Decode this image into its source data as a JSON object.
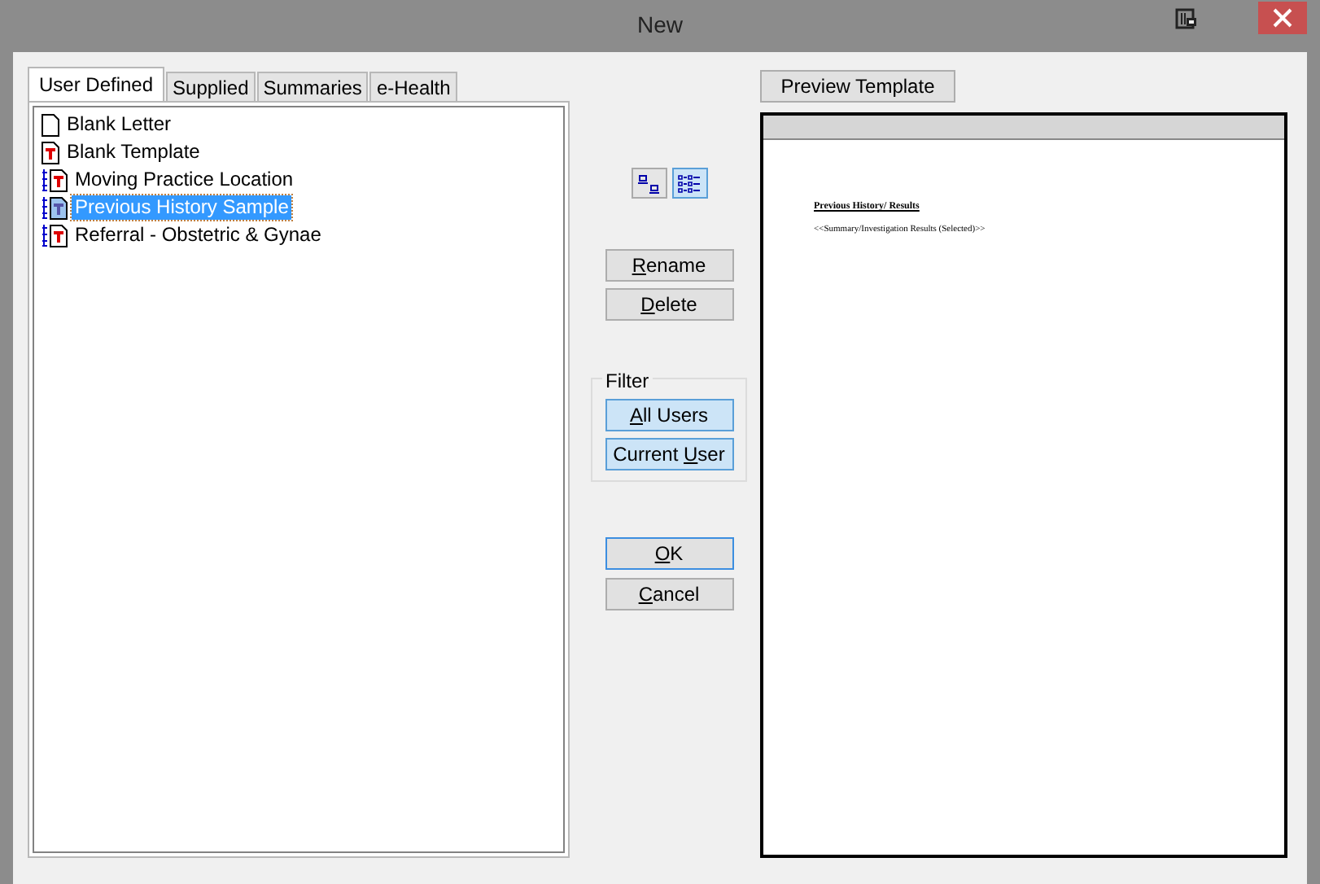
{
  "window": {
    "title": "New"
  },
  "tabs": [
    {
      "label": "User Defined",
      "selected": true
    },
    {
      "label": "Supplied",
      "selected": false
    },
    {
      "label": "Summaries",
      "selected": false
    },
    {
      "label": "e-Health",
      "selected": false
    }
  ],
  "templates": [
    {
      "name": "Blank Letter",
      "kind": "letter",
      "selected": false
    },
    {
      "name": "Blank Template",
      "kind": "template",
      "selected": false
    },
    {
      "name": "Moving Practice Location",
      "kind": "all-template",
      "selected": false
    },
    {
      "name": "Previous History Sample",
      "kind": "all-template",
      "selected": true
    },
    {
      "name": "Referral - Obstetric & Gynae",
      "kind": "all-template",
      "selected": false
    }
  ],
  "view_buttons": [
    {
      "kind": "large",
      "selected": false
    },
    {
      "kind": "list",
      "selected": true
    }
  ],
  "actions": [
    {
      "key": "R",
      "after": "ename"
    },
    {
      "key": "D",
      "after": "elete"
    }
  ],
  "filter": {
    "label": "Filter",
    "buttons": [
      {
        "key": "A",
        "after": "ll Users",
        "selected": true
      },
      {
        "before": "Current ",
        "key": "U",
        "after": "ser",
        "selected": true
      }
    ]
  },
  "dialog_buttons": [
    {
      "key": "O",
      "after": "K",
      "default": true
    },
    {
      "key": "C",
      "after": "ancel",
      "default": false
    }
  ],
  "preview": {
    "button": "Preview Template",
    "heading": "Previous History/ Results",
    "field": "<<Summary/Investigation Results (Selected)>>"
  }
}
